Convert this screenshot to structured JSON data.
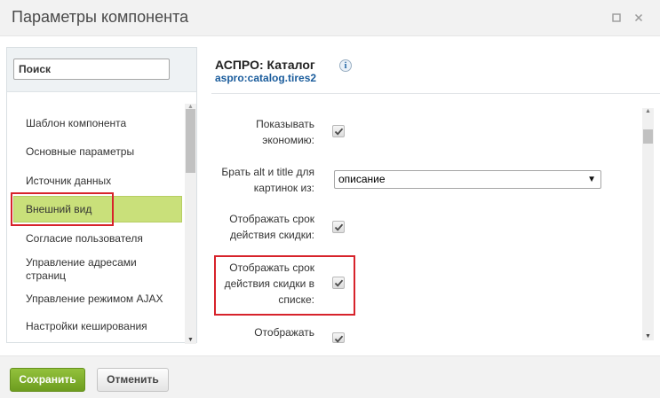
{
  "dialog": {
    "title": "Параметры компонента"
  },
  "search": {
    "placeholder": "Поиск"
  },
  "sidebar": {
    "items": [
      {
        "label": "Шаблон компонента"
      },
      {
        "label": "Основные параметры"
      },
      {
        "label": "Источник данных"
      },
      {
        "label": "Внешний вид",
        "active": true,
        "highlighted": true
      },
      {
        "label": "Согласие пользователя"
      },
      {
        "label": "Управление адресами страниц"
      },
      {
        "label": "Управление режимом AJAX"
      },
      {
        "label": "Настройки кеширования"
      }
    ]
  },
  "component": {
    "title": "АСПРО: Каталог",
    "code": "aspro:catalog.tires2"
  },
  "options": [
    {
      "label": "Показывать экономию:",
      "type": "checkbox",
      "checked": true
    },
    {
      "label": "Брать alt и title для картинок из:",
      "type": "select",
      "value": "описание"
    },
    {
      "label": "Отображать срок действия скидки:",
      "type": "checkbox",
      "checked": true
    },
    {
      "label": "Отображать срок действия скидки в списке:",
      "type": "checkbox",
      "checked": true,
      "highlighted": true
    },
    {
      "label": "Отображать",
      "type": "checkbox",
      "checked": true
    }
  ],
  "footer": {
    "save_label": "Сохранить",
    "cancel_label": "Отменить"
  },
  "colors": {
    "accent_green": "#7fae2e",
    "active_item_bg": "#c9e07a",
    "highlight_red": "#d7232b",
    "link_blue": "#1a5c9c"
  }
}
